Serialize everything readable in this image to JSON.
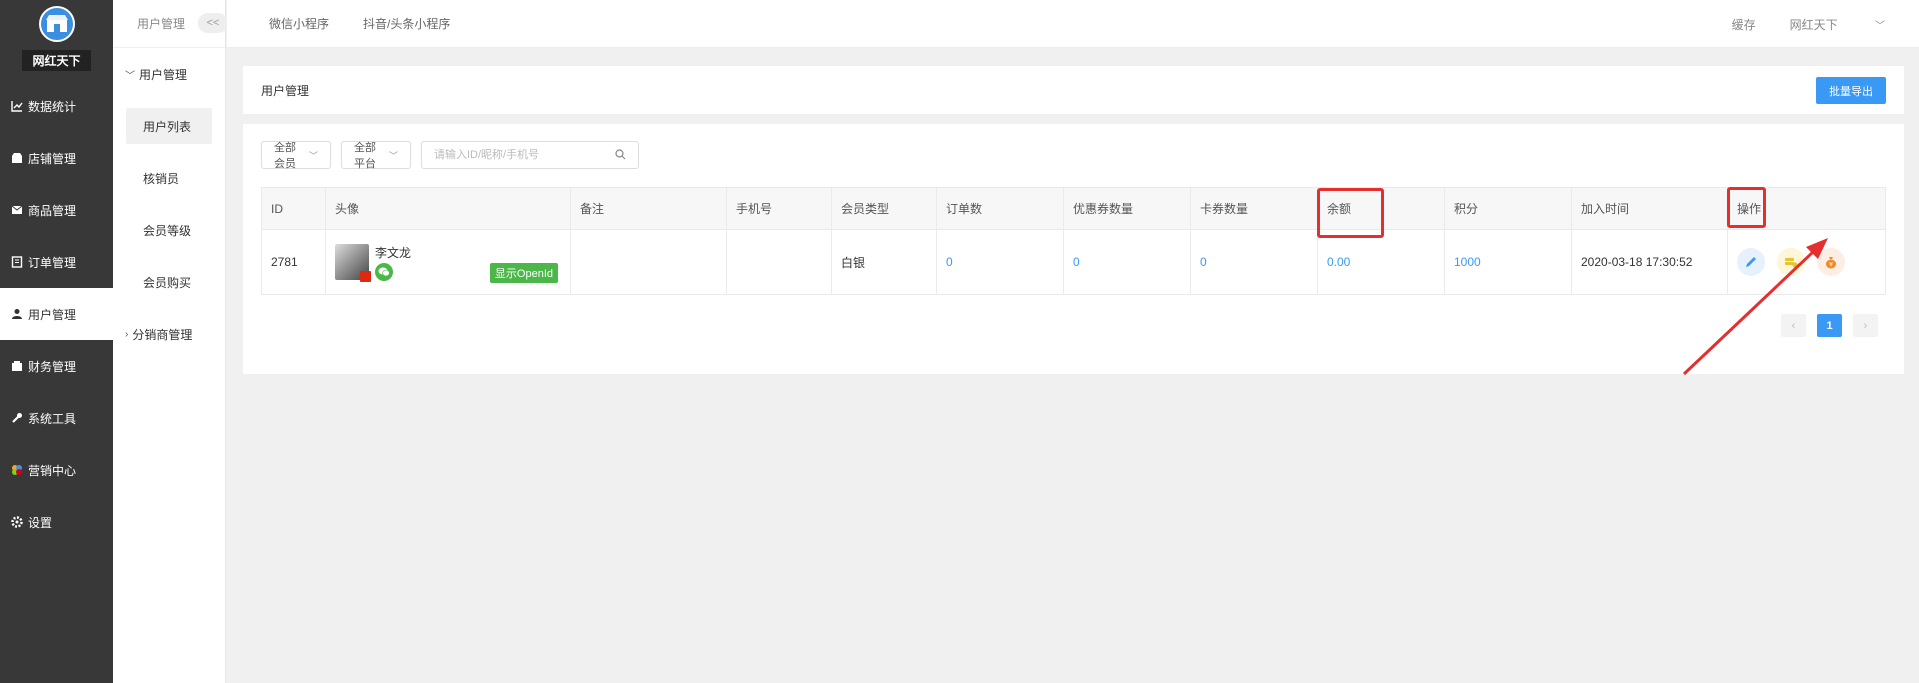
{
  "sidebar": {
    "shop_name": "网红天下",
    "items": [
      {
        "label": "数据统计",
        "icon": "chart-icon"
      },
      {
        "label": "店铺管理",
        "icon": "shop-icon"
      },
      {
        "label": "商品管理",
        "icon": "goods-icon"
      },
      {
        "label": "订单管理",
        "icon": "order-icon"
      },
      {
        "label": "用户管理",
        "icon": "user-icon"
      },
      {
        "label": "财务管理",
        "icon": "finance-icon"
      },
      {
        "label": "系统工具",
        "icon": "wrench-icon"
      },
      {
        "label": "营销中心",
        "icon": "marketing-icon"
      },
      {
        "label": "设置",
        "icon": "gear-icon"
      }
    ]
  },
  "subbar": {
    "title": "用户管理",
    "collapse": "<<",
    "group1": "用户管理",
    "items": [
      "用户列表",
      "核销员",
      "会员等级",
      "会员购买"
    ],
    "group2": "分销商管理"
  },
  "topbar": {
    "tabs": [
      "微信小程序",
      "抖音/头条小程序"
    ],
    "cache": "缓存",
    "user": "网红天下"
  },
  "main": {
    "title": "用户管理",
    "export_label": "批量导出",
    "filters": {
      "member": "全部会员",
      "platform": "全部平台",
      "search_placeholder": "请输入ID/昵称/手机号"
    },
    "columns": [
      "ID",
      "头像",
      "备注",
      "手机号",
      "会员类型",
      "订单数",
      "优惠券数量",
      "卡券数量",
      "余额",
      "积分",
      "加入时间",
      "操作"
    ],
    "row": {
      "id": "2781",
      "nickname": "李文龙",
      "openid_label": "显示OpenId",
      "remark": "",
      "phone": "",
      "member_type": "白银",
      "orders": "0",
      "coupons": "0",
      "cards": "0",
      "balance": "0.00",
      "points": "1000",
      "join_time": "2020-03-18 17:30:52"
    },
    "pagination": {
      "prev": "‹",
      "current": "1",
      "next": "›"
    }
  },
  "colors": {
    "accent": "#3a99f5",
    "sidebar": "#383838",
    "highlight": "#e52e2e",
    "wechat": "#4cb749"
  }
}
